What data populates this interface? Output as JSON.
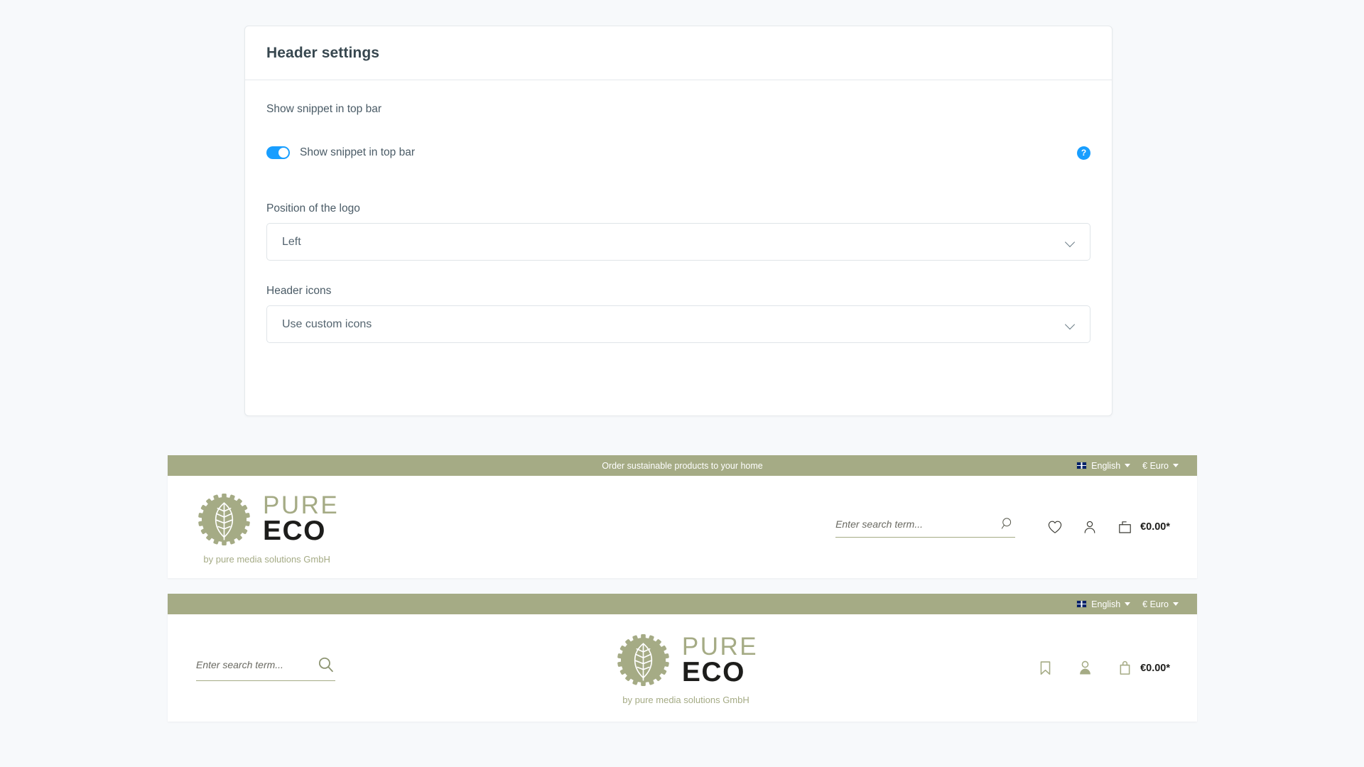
{
  "settings": {
    "title": "Header settings",
    "snippet_section_label": "Show snippet in top bar",
    "toggle_label": "Show snippet in top bar",
    "toggle_state": "on",
    "help_glyph": "?",
    "logo_position_label": "Position of the logo",
    "logo_position_value": "Left",
    "header_icons_label": "Header icons",
    "header_icons_value": "Use custom icons",
    "accent_color": "#189eff"
  },
  "preview_1": {
    "topbar": {
      "snippet": "Order sustainable products to your home",
      "language": "English",
      "currency": "€ Euro",
      "bar_color": "#a5ab85"
    },
    "logo": {
      "word_top": "PURE",
      "word_bottom": "ECO",
      "tagline": "by pure media solutions GmbH",
      "mark_color": "#a5ab85",
      "word_top_color": "#a5ab85",
      "word_bottom_color": "#1d1d1b"
    },
    "search_placeholder": "Enter search term...",
    "icons": [
      "heart-icon",
      "user-icon",
      "cart-bag-icon"
    ],
    "cart_price": "€0.00*"
  },
  "preview_2": {
    "topbar": {
      "snippet": "",
      "language": "English",
      "currency": "€ Euro",
      "bar_color": "#a5ab85"
    },
    "logo": {
      "word_top": "PURE",
      "word_bottom": "ECO",
      "tagline": "by pure media solutions GmbH",
      "mark_color": "#a5ab85",
      "word_top_color": "#a5ab85",
      "word_bottom_color": "#1d1d1b"
    },
    "search_placeholder": "Enter search term...",
    "icons": [
      "bookmark-icon",
      "user-filled-icon",
      "bag-handle-icon"
    ],
    "cart_price": "€0.00*"
  }
}
